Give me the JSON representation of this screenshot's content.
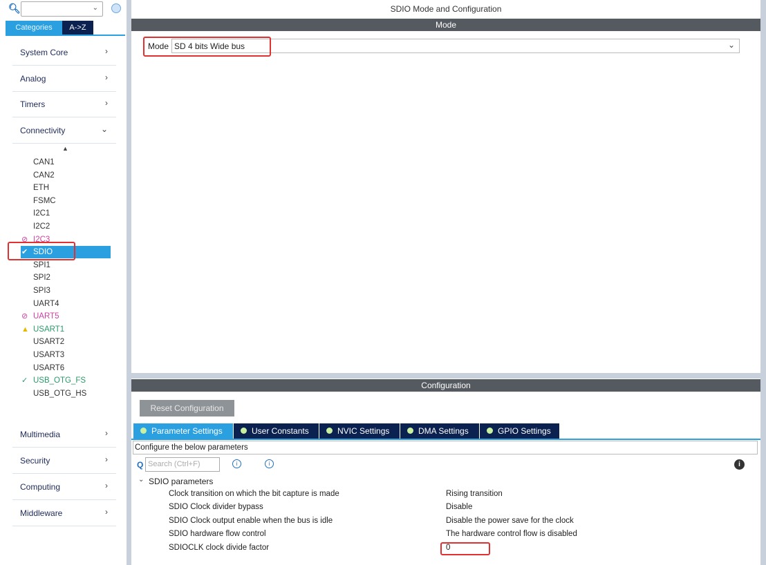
{
  "sidebar": {
    "search_value": "",
    "tabs": [
      {
        "label": "Categories",
        "active": true
      },
      {
        "label": "A->Z",
        "active": false
      }
    ],
    "categories_top": [
      {
        "label": "System Core",
        "chevron": ">"
      },
      {
        "label": "Analog",
        "chevron": ">"
      },
      {
        "label": "Timers",
        "chevron": ">"
      },
      {
        "label": "Connectivity",
        "chevron": "v"
      }
    ],
    "connectivity_items": [
      {
        "label": "CAN1",
        "status": "none"
      },
      {
        "label": "CAN2",
        "status": "none"
      },
      {
        "label": "ETH",
        "status": "none"
      },
      {
        "label": "FSMC",
        "status": "none"
      },
      {
        "label": "I2C1",
        "status": "none"
      },
      {
        "label": "I2C2",
        "status": "none"
      },
      {
        "label": "I2C3",
        "status": "disabled"
      },
      {
        "label": "SDIO",
        "status": "selected-ok"
      },
      {
        "label": "SPI1",
        "status": "none"
      },
      {
        "label": "SPI2",
        "status": "none"
      },
      {
        "label": "SPI3",
        "status": "none"
      },
      {
        "label": "UART4",
        "status": "none"
      },
      {
        "label": "UART5",
        "status": "disabled"
      },
      {
        "label": "USART1",
        "status": "warning"
      },
      {
        "label": "USART2",
        "status": "none"
      },
      {
        "label": "USART3",
        "status": "none"
      },
      {
        "label": "USART6",
        "status": "none"
      },
      {
        "label": "USB_OTG_FS",
        "status": "ok"
      },
      {
        "label": "USB_OTG_HS",
        "status": "none"
      }
    ],
    "categories_bottom": [
      {
        "label": "Multimedia",
        "chevron": ">"
      },
      {
        "label": "Security",
        "chevron": ">"
      },
      {
        "label": "Computing",
        "chevron": ">"
      },
      {
        "label": "Middleware",
        "chevron": ">"
      }
    ]
  },
  "main": {
    "title": "SDIO Mode and Configuration",
    "mode_header": "Mode",
    "mode_label": "Mode",
    "mode_value": "SD 4 bits Wide bus",
    "config_header": "Configuration",
    "reset_label": "Reset Configuration",
    "tabs": [
      {
        "label": "Parameter Settings",
        "active": true
      },
      {
        "label": "User Constants"
      },
      {
        "label": "NVIC Settings"
      },
      {
        "label": "DMA Settings"
      },
      {
        "label": "GPIO Settings"
      }
    ],
    "configure_text": "Configure the below parameters",
    "search_placeholder": "Search (Ctrl+F)",
    "group_label": "SDIO parameters",
    "params": [
      {
        "name": "Clock transition on which the bit capture is made",
        "value": "Rising transition"
      },
      {
        "name": "SDIO Clock divider bypass",
        "value": "Disable"
      },
      {
        "name": "SDIO Clock output enable when the bus is idle",
        "value": "Disable the power save for the clock"
      },
      {
        "name": "SDIO hardware flow control",
        "value": "The hardware control flow is disabled"
      },
      {
        "name": "SDIOCLK clock divide factor",
        "value": "0"
      }
    ]
  },
  "colors": {
    "accent": "#2aa0e0",
    "tab_dark": "#0b2150",
    "highlight": "#e03030",
    "header": "#555a60"
  }
}
